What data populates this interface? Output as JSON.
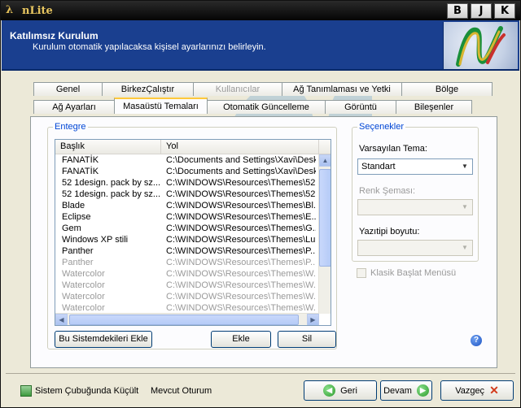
{
  "window": {
    "title": "nLite",
    "title_buttons": [
      "B",
      "J",
      "K"
    ]
  },
  "header": {
    "title": "Katılımsız Kurulum",
    "subtitle": "Kurulum otomatik yapılacaksa kişisel ayarlarınızı belirleyin."
  },
  "tabs": {
    "row1": [
      {
        "label": "Genel",
        "disabled": false
      },
      {
        "label": "BirkezÇalıştır",
        "disabled": false
      },
      {
        "label": "Kullanıcılar",
        "disabled": true
      },
      {
        "label": "Ağ Tanımlaması ve Yetki",
        "disabled": false
      },
      {
        "label": "Bölge",
        "disabled": false
      }
    ],
    "row2": [
      {
        "label": "Ağ Ayarları",
        "disabled": false
      },
      {
        "label": "Masaüstü Temaları",
        "active": true
      },
      {
        "label": "Otomatik Güncelleme",
        "disabled": false
      },
      {
        "label": "Görüntü",
        "disabled": false
      },
      {
        "label": "Bileşenler",
        "disabled": false
      }
    ]
  },
  "integrate": {
    "group_label": "Entegre",
    "columns": [
      "Başlık",
      "Yol"
    ],
    "rows": [
      {
        "title": "FANATİK",
        "path": "C:\\Documents and Settings\\Xavi\\Desk...",
        "dim": false
      },
      {
        "title": "FANATİK",
        "path": "C:\\Documents and Settings\\Xavi\\Desk...",
        "dim": false
      },
      {
        "title": "52 1design. pack by sz...",
        "path": "C:\\WINDOWS\\Resources\\Themes\\52...",
        "dim": false
      },
      {
        "title": "52 1design. pack by sz...",
        "path": "C:\\WINDOWS\\Resources\\Themes\\52...",
        "dim": false
      },
      {
        "title": "Blade",
        "path": "C:\\WINDOWS\\Resources\\Themes\\Bl...",
        "dim": false
      },
      {
        "title": "Eclipse",
        "path": "C:\\WINDOWS\\Resources\\Themes\\E...",
        "dim": false
      },
      {
        "title": "Gem",
        "path": "C:\\WINDOWS\\Resources\\Themes\\G...",
        "dim": false
      },
      {
        "title": "Windows XP stili",
        "path": "C:\\WINDOWS\\Resources\\Themes\\Lu...",
        "dim": false
      },
      {
        "title": "Panther",
        "path": "C:\\WINDOWS\\Resources\\Themes\\P...",
        "dim": false
      },
      {
        "title": "Panther",
        "path": "C:\\WINDOWS\\Resources\\Themes\\P...",
        "dim": true
      },
      {
        "title": "Watercolor",
        "path": "C:\\WINDOWS\\Resources\\Themes\\W...",
        "dim": true
      },
      {
        "title": "Watercolor",
        "path": "C:\\WINDOWS\\Resources\\Themes\\W...",
        "dim": true
      },
      {
        "title": "Watercolor",
        "path": "C:\\WINDOWS\\Resources\\Themes\\W...",
        "dim": true
      },
      {
        "title": "Watercolor",
        "path": "C:\\WINDOWS\\Resources\\Themes\\W...",
        "dim": true
      }
    ],
    "buttons": {
      "add_system": "Bu Sistemdekileri Ekle",
      "add": "Ekle",
      "delete": "Sil"
    }
  },
  "options": {
    "group_label": "Seçenekler",
    "default_theme_label": "Varsayılan Tema:",
    "default_theme_value": "Standart",
    "color_scheme_label": "Renk Şeması:",
    "color_scheme_value": "",
    "font_size_label": "Yazıtipi boyutu:",
    "font_size_value": "",
    "classic_start_label": "Klasik Başlat Menüsü"
  },
  "footer": {
    "minimize_to_tray": "Sistem Çubuğunda Küçült",
    "current_session": "Mevcut Oturum",
    "back": "Geri",
    "next": "Devam",
    "cancel": "Vazgeç"
  },
  "colors": {
    "header_bg": "#1a3f8f",
    "accent_tab": "#ffc83c",
    "group_label": "#0046d5"
  }
}
